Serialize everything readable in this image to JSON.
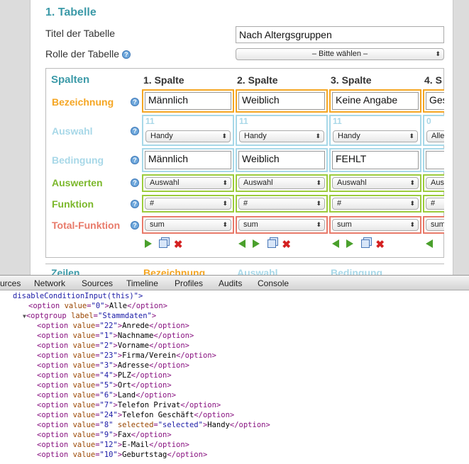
{
  "section": {
    "title": "1. Tabelle",
    "name_label": "Titel der Tabelle",
    "name_value": "Nach Altergsgruppen",
    "role_label": "Rolle der Tabelle",
    "role_value": "– Bitte wählen –",
    "help_glyph": "?"
  },
  "spalten": {
    "title": "Spalten",
    "columns": [
      "1. Spalte",
      "2. Spalte",
      "3. Spalte",
      "4. S"
    ],
    "categories": {
      "bezeichnung": "Bezeichnung",
      "auswahl": "Auswahl",
      "bedingung": "Bedingung",
      "auswerten": "Auswerten",
      "funktion": "Funktion",
      "total": "Total-Funktion"
    },
    "colors": {
      "bezeichnung": "#f5a623",
      "auswahl": "#a8d8e8",
      "bedingung": "#a8d8e8",
      "auswerten": "#7cb82c",
      "funktion": "#7cb82c",
      "total": "#e87a6a"
    },
    "bezeichnung_values": [
      "Männlich",
      "Weiblich",
      "Keine Angabe",
      "Ges"
    ],
    "auswahl_counts": [
      "11",
      "11",
      "11",
      "0"
    ],
    "auswahl_values": [
      "Handy",
      "Handy",
      "Handy",
      "Alle"
    ],
    "bedingung_values": [
      "Männlich",
      "Weiblich",
      "FEHLT",
      ""
    ],
    "auswerten_values": [
      "Auswahl",
      "Auswahl",
      "Auswahl",
      "Aus"
    ],
    "funktion_values": [
      "#",
      "#",
      "#",
      "#"
    ],
    "total_values": [
      "sum",
      "sum",
      "sum",
      "sum"
    ],
    "delete_glyph": "✖"
  },
  "zeilen": {
    "title": "Zeilen",
    "bezeichnung": "Bezeichnung",
    "auswahl": "Auswahl",
    "bedingung": "Bedingung"
  },
  "devtools": {
    "tabs": [
      "urces",
      "Network",
      "Sources",
      "Timeline",
      "Profiles",
      "Audits",
      "Console"
    ]
  },
  "code": {
    "line0": "disableConditionInput(this)\">",
    "alle_value": "\"0\"",
    "alle_text": "Alle",
    "optgroup_label": "\"Stammdaten\"",
    "selected_attr": "selected",
    "selected_val": "\"selected\"",
    "options": [
      {
        "value": "\"22\"",
        "text": "Anrede"
      },
      {
        "value": "\"1\"",
        "text": "Nachname"
      },
      {
        "value": "\"2\"",
        "text": "Vorname"
      },
      {
        "value": "\"23\"",
        "text": "Firma/Verein"
      },
      {
        "value": "\"3\"",
        "text": "Adresse"
      },
      {
        "value": "\"4\"",
        "text": "PLZ"
      },
      {
        "value": "\"5\"",
        "text": "Ort"
      },
      {
        "value": "\"6\"",
        "text": "Land"
      },
      {
        "value": "\"7\"",
        "text": "Telefon Privat"
      },
      {
        "value": "\"24\"",
        "text": "Telefon Geschäft"
      },
      {
        "value": "\"8\"",
        "text": "Handy"
      },
      {
        "value": "\"9\"",
        "text": "Fax"
      },
      {
        "value": "\"12\"",
        "text": "E-Mail"
      },
      {
        "value": "\"10\"",
        "text": "Geburtstag"
      }
    ]
  }
}
